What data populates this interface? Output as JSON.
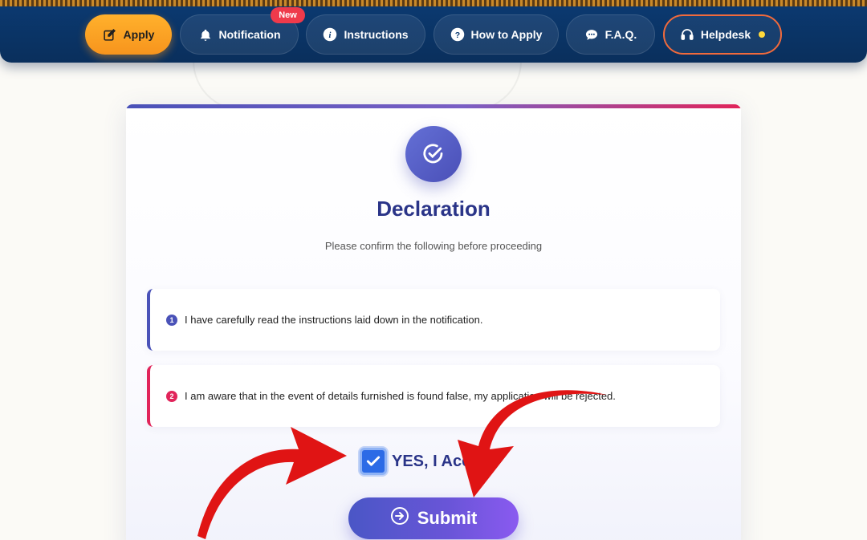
{
  "nav": {
    "apply_label": "Apply",
    "notification_label": "Notification",
    "new_badge": "New",
    "instructions_label": "Instructions",
    "how_to_apply_label": "How to Apply",
    "faq_label": "F.A.Q.",
    "helpdesk_label": "Helpdesk"
  },
  "declaration": {
    "title": "Declaration",
    "subtitle": "Please confirm the following before proceeding",
    "items": [
      {
        "number": "1",
        "text": "I have carefully read the instructions laid down in the notification."
      },
      {
        "number": "2",
        "text": "I am aware that in the event of details furnished is found false, my application will be rejected."
      }
    ],
    "accept_label": "YES, I Accept",
    "accept_checked": true,
    "submit_label": "Submit"
  },
  "colors": {
    "nav_bg": "#0b3a72",
    "apply_accent": "#f7941d",
    "title": "#2a3488",
    "item1_accent": "#4a52b8",
    "item2_accent": "#e1245a",
    "annotation_arrow": "#e01414"
  },
  "icons": {
    "apply": "edit-icon",
    "notification": "bell-icon",
    "instructions": "info-icon",
    "how_to_apply": "question-icon",
    "faq": "chat-icon",
    "helpdesk": "headset-icon",
    "declaration": "check-circle-icon",
    "submit": "arrow-circle-right-icon"
  }
}
